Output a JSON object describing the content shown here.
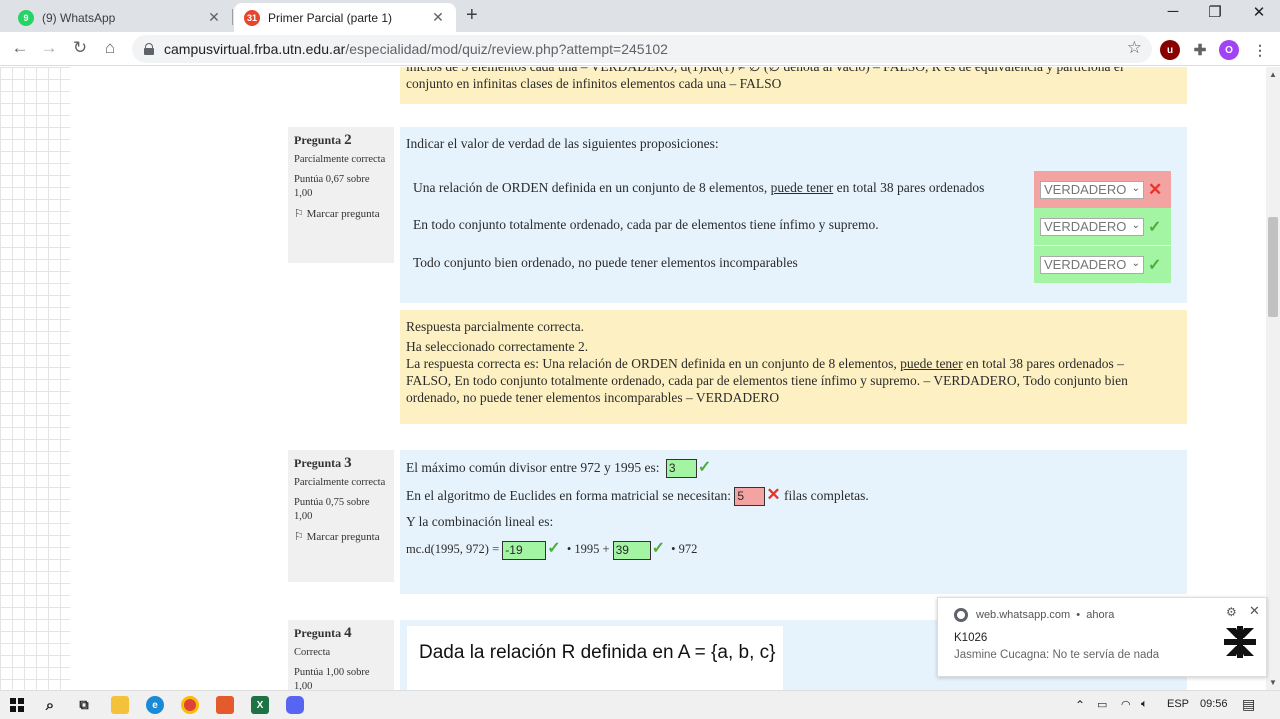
{
  "browser": {
    "tabs": [
      {
        "label": "(9) WhatsApp",
        "badge": "9",
        "active": false
      },
      {
        "label": "Primer Parcial (parte 1)",
        "badge": "31",
        "active": true
      }
    ],
    "url_host": "campusvirtual.frba.utn.edu.ar",
    "url_path": "/especialidad/mod/quiz/review.php?attempt=245102",
    "profile_initial": "O"
  },
  "top_feedback": {
    "line1": "inicios de 5 elementos cada una – VERDADERO, d(1)Rd(1) ≠ ∅ (∅ denota al vacío) – FALSO, R es de equivalencia y particiona el",
    "line2": "conjunto en infinitas clases de infinitos elementos cada una – FALSO"
  },
  "q2": {
    "label": "Pregunta",
    "number": "2",
    "status": "Parcialmente correcta",
    "score": "Puntúa 0,67 sobre 1,00",
    "flag": "Marcar pregunta",
    "prompt": "Indicar el valor de verdad de las siguientes proposiciones:",
    "rows": [
      {
        "pre": "Una relación de ORDEN definida en un conjunto de 8 elementos, ",
        "underline": "puede tener",
        "post": " en total 38 pares ordenados",
        "answer": "VERDADERO"
      },
      {
        "pre": "En todo conjunto totalmente ordenado, cada par de elementos tiene ínfimo y supremo.",
        "underline": "",
        "post": "",
        "answer": "VERDADERO"
      },
      {
        "pre": "Todo conjunto bien ordenado, no puede tener elementos incomparables",
        "underline": "",
        "post": "",
        "answer": "VERDADERO"
      }
    ],
    "feedback": {
      "status": "Respuesta parcialmente correcta.",
      "selected": "Ha seleccionado correctamente 2.",
      "l1a": "La respuesta correcta es: Una relación de ORDEN definida en un conjunto de 8 elementos, ",
      "l1u": "puede tener",
      "l1b": " en total 38 pares ordenados –",
      "l2": "FALSO, En todo conjunto totalmente ordenado, cada par de elementos tiene ínfimo y supremo. – VERDADERO, Todo conjunto bien",
      "l3": "ordenado, no puede tener elementos incomparables – VERDADERO"
    }
  },
  "q3": {
    "label": "Pregunta",
    "number": "3",
    "status": "Parcialmente correcta",
    "score": "Puntúa 0,75 sobre 1,00",
    "flag": "Marcar pregunta",
    "mcd_text": "El máximo común divisor entre 972 y 1995 es:",
    "mcd_value": "3",
    "euclid_pre": "En el algoritmo de Euclides en forma matricial se necesitan:",
    "euclid_value": "5",
    "euclid_post": "filas completas.",
    "comb_text": "Y la combinación lineal es:",
    "formula_pre": "mc.d(1995, 972) =",
    "coef1": "-19",
    "mid": "• 1995 +",
    "coef2": "39",
    "end": "• 972"
  },
  "q4": {
    "label": "Pregunta",
    "number": "4",
    "status": "Correcta",
    "score": "Puntúa 1,00 sobre 1,00",
    "card_title": "Dada la relación R definida en A = {a, b, c}"
  },
  "notification": {
    "source": "web.whatsapp.com",
    "time": "ahora",
    "title": "K1026",
    "message": "Jasmine Cucagna: No te servía de nada"
  },
  "taskbar": {
    "lang": "ESP",
    "time": "09:56"
  }
}
